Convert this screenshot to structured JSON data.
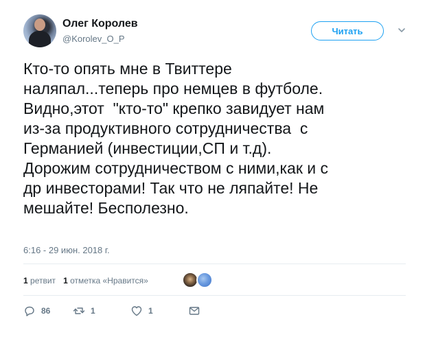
{
  "author": {
    "name": "Олег Королев",
    "handle": "@Korolev_O_P"
  },
  "follow_button": {
    "label": "Читать"
  },
  "tweet": {
    "text": "Кто-то опять мне в Твиттере\nналяпал...теперь про немцев в футболе.\nВидно,этот  \"кто-то\" крепко завидует нам\nиз-за продуктивного сотрудничества  с\nГерманией (инвестиции,СП и т.д).\nДорожим сотрудничеством с ними,как и с\nдр инвесторами! Так что не ляпайте! Не\nмешайте! Бесполезно.",
    "timestamp": "6:16 - 29 июн. 2018 г."
  },
  "stats": {
    "retweets_count": "1",
    "retweets_label": "ретвит",
    "likes_count": "1",
    "likes_label": "отметка «Нравится»"
  },
  "actions": {
    "replies": "86",
    "retweets": "1",
    "likes": "1"
  },
  "icons": [
    "avatar",
    "chevron-down-icon",
    "reply-icon",
    "retweet-icon",
    "heart-icon",
    "message-icon"
  ],
  "colors": {
    "accent": "#1da1f2",
    "muted": "#657786",
    "text": "#14171a"
  }
}
